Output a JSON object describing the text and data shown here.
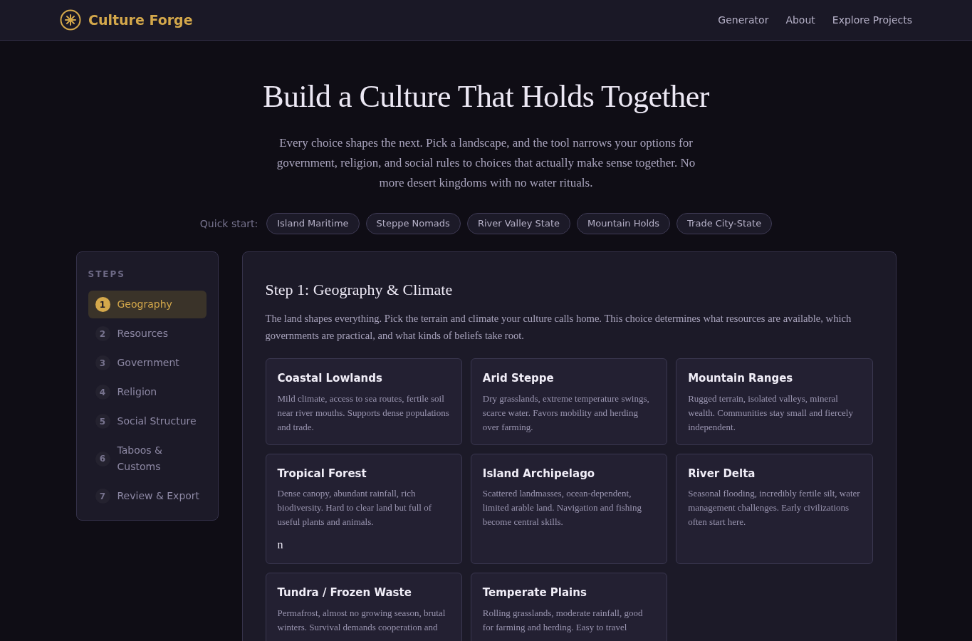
{
  "brand": {
    "name": "Culture Forge"
  },
  "nav": [
    "Generator",
    "About",
    "Explore Projects"
  ],
  "hero": {
    "title": "Build a Culture That Holds Together",
    "intro": "Every choice shapes the next. Pick a landscape, and the tool narrows your options for government, religion, and social rules to choices that actually make sense together. No more desert kingdoms with no water rituals."
  },
  "quick_start": {
    "label": "Quick start:",
    "presets": [
      "Island Maritime",
      "Steppe Nomads",
      "River Valley State",
      "Mountain Holds",
      "Trade City-State"
    ]
  },
  "steps": {
    "heading": "STEPS",
    "items": [
      {
        "number": "1",
        "label": "Geography",
        "selected": true
      },
      {
        "number": "2",
        "label": "Resources",
        "selected": false
      },
      {
        "number": "3",
        "label": "Government",
        "selected": false
      },
      {
        "number": "4",
        "label": "Religion",
        "selected": false
      },
      {
        "number": "5",
        "label": "Social Structure",
        "selected": false
      },
      {
        "number": "6",
        "label": "Taboos & Customs",
        "selected": false
      },
      {
        "number": "7",
        "label": "Review & Export",
        "selected": false
      }
    ]
  },
  "panel": {
    "title": "Step 1: Geography & Climate",
    "description": "The land shapes everything. Pick the terrain and climate your culture calls home. This choice determines what resources are available, which governments are practical, and what kinds of beliefs take root.",
    "options": [
      {
        "title": "Coastal Lowlands",
        "text": "Mild climate, access to sea routes, fertile soil near river mouths. Supports dense populations and trade."
      },
      {
        "title": "Arid Steppe",
        "text": "Dry grasslands, extreme temperature swings, scarce water. Favors mobility and herding over farming."
      },
      {
        "title": "Mountain Ranges",
        "text": "Rugged terrain, isolated valleys, mineral wealth. Communities stay small and fiercely independent."
      },
      {
        "title": "Tropical Forest",
        "text": "Dense canopy, abundant rainfall, rich biodiversity. Hard to clear land but full of useful plants and animals.",
        "extra": "n"
      },
      {
        "title": "Island Archipelago",
        "text": "Scattered landmasses, ocean-dependent, limited arable land. Navigation and fishing become central skills."
      },
      {
        "title": "River Delta",
        "text": "Seasonal flooding, incredibly fertile silt, water management challenges. Early civilizations often start here."
      },
      {
        "title": "Tundra / Frozen Waste",
        "text": "Permafrost, almost no growing season, brutal winters. Survival demands cooperation and"
      },
      {
        "title": "Temperate Plains",
        "text": "Rolling grasslands, moderate rainfall, good for farming and herding. Easy to travel"
      }
    ]
  }
}
